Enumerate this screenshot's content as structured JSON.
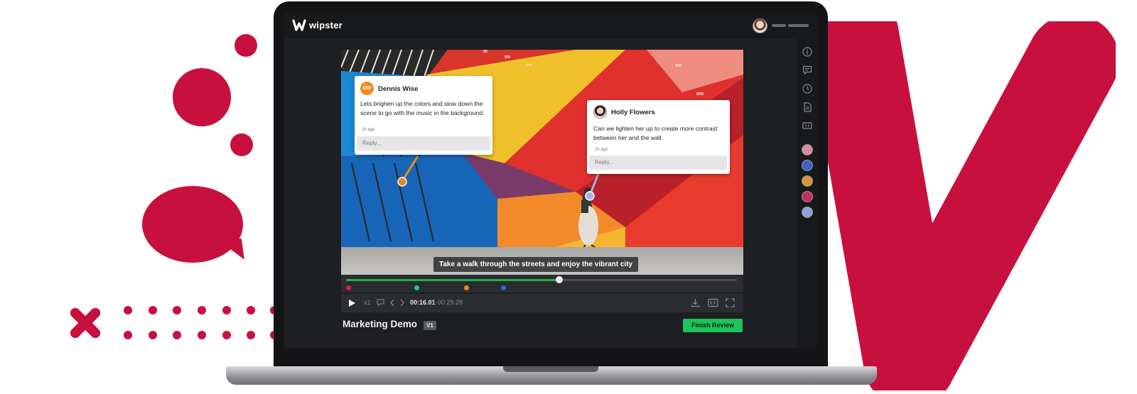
{
  "app": {
    "logo_text": "wipster"
  },
  "comments": [
    {
      "initials": "DW",
      "author": "Dennis Wise",
      "text": "Lets brighen up the colors and slow down the scene to go with the music in the background.",
      "time": "2h ago",
      "reply_placeholder": "Reply..."
    },
    {
      "author": "Holly Flowers",
      "text": "Can we lighten her up to create more contrast between her and the wall.",
      "time": "2h ago",
      "reply_placeholder": "Reply..."
    }
  ],
  "video": {
    "caption": "Take a walk through the streets and enjoy the vibrant city"
  },
  "playback": {
    "speed": "x1",
    "current_time": "00:16.01",
    "separator": "/",
    "total_time": "00:29.28",
    "progress": 0.545,
    "markers": [
      {
        "position": 0.007,
        "color": "#e8174f"
      },
      {
        "position": 0.181,
        "color": "#19c2b0"
      },
      {
        "position": 0.309,
        "color": "#f08a1c"
      },
      {
        "position": 0.402,
        "color": "#2b6be0"
      }
    ]
  },
  "project": {
    "title": "Marketing Demo",
    "version": "V1",
    "finish_label": "Finish Review"
  },
  "sidebar": {
    "icons": [
      "info-icon",
      "comments-icon",
      "history-icon",
      "document-icon",
      "captions-icon"
    ],
    "reviewers": [
      "#d98aa6",
      "#3f63c9",
      "#d8943c",
      "#c2305a",
      "#8aa6d8"
    ]
  },
  "colors": {
    "brand": "#c8103f",
    "accent_green": "#1ec35a"
  }
}
